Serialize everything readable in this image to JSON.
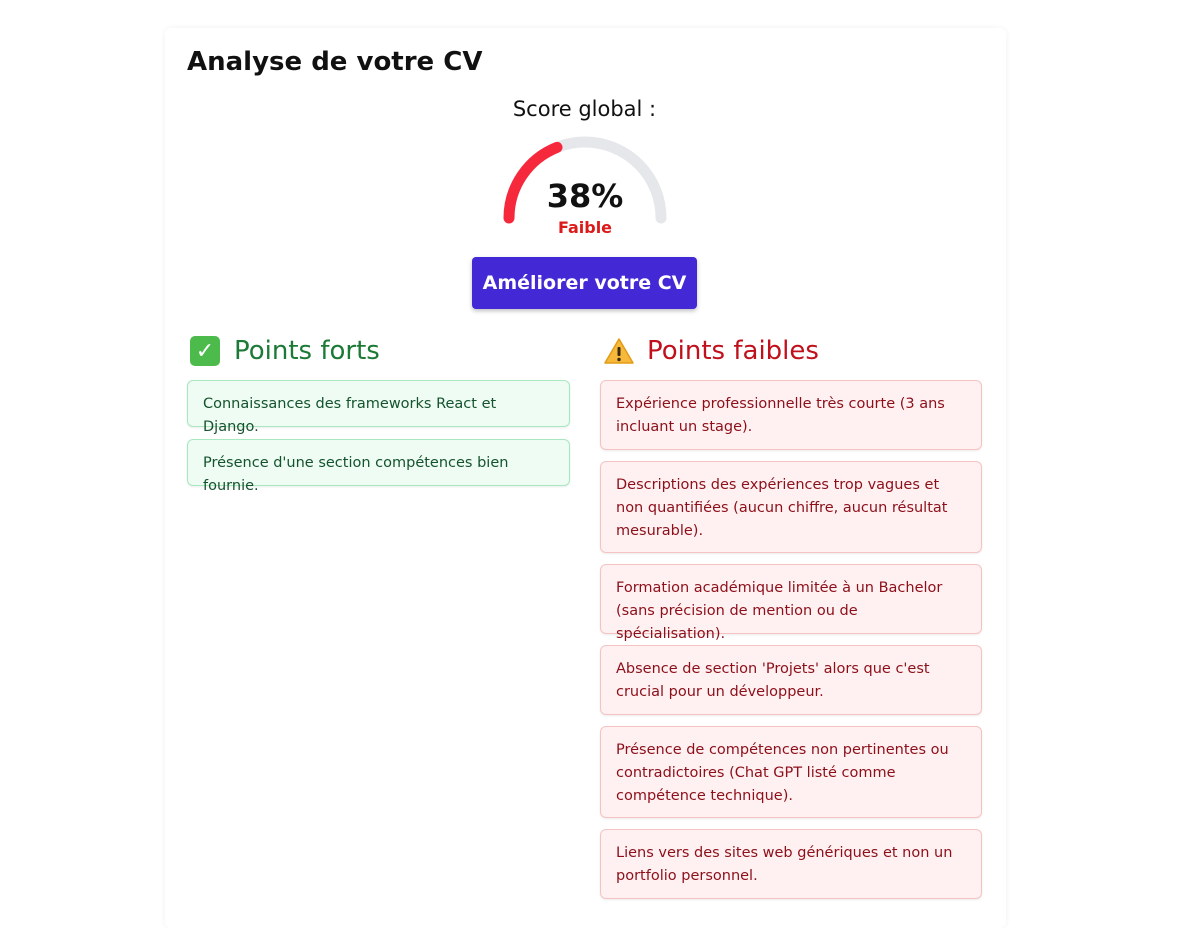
{
  "page": {
    "title": "Analyse de votre CV",
    "score_label": "Score global :",
    "score_percent": 38,
    "score_text": "38%",
    "score_level": "Faible",
    "improve_button_label": "Améliorer votre CV"
  },
  "strengths": {
    "heading": "Points forts",
    "icon": "check-mark-icon",
    "items": [
      "Connaissances des frameworks React et Django.",
      "Présence d'une section compétences bien fournie."
    ]
  },
  "weaknesses": {
    "heading": "Points faibles",
    "icon": "warning-icon",
    "items": [
      "Expérience professionnelle très courte (3 ans incluant un stage).",
      "Descriptions des expériences trop vagues et non quantifiées (aucun chiffre, aucun résultat mesurable).",
      "Formation académique limitée à un Bachelor (sans précision de mention ou de spécialisation).",
      "Absence de section 'Projets' alors que c'est crucial pour un développeur.",
      "Présence de compétences non pertinentes ou contradictoires (Chat GPT listé comme compétence technique).",
      "Liens vers des sites web génériques et non un portfolio personnel."
    ]
  },
  "colors": {
    "gauge_fill": "#f6293c",
    "gauge_track": "#e5e7eb",
    "level_text": "#dc1a1a",
    "button_bg": "#4328d6",
    "strong_heading": "#1b7a35",
    "weak_heading": "#c0101b"
  }
}
